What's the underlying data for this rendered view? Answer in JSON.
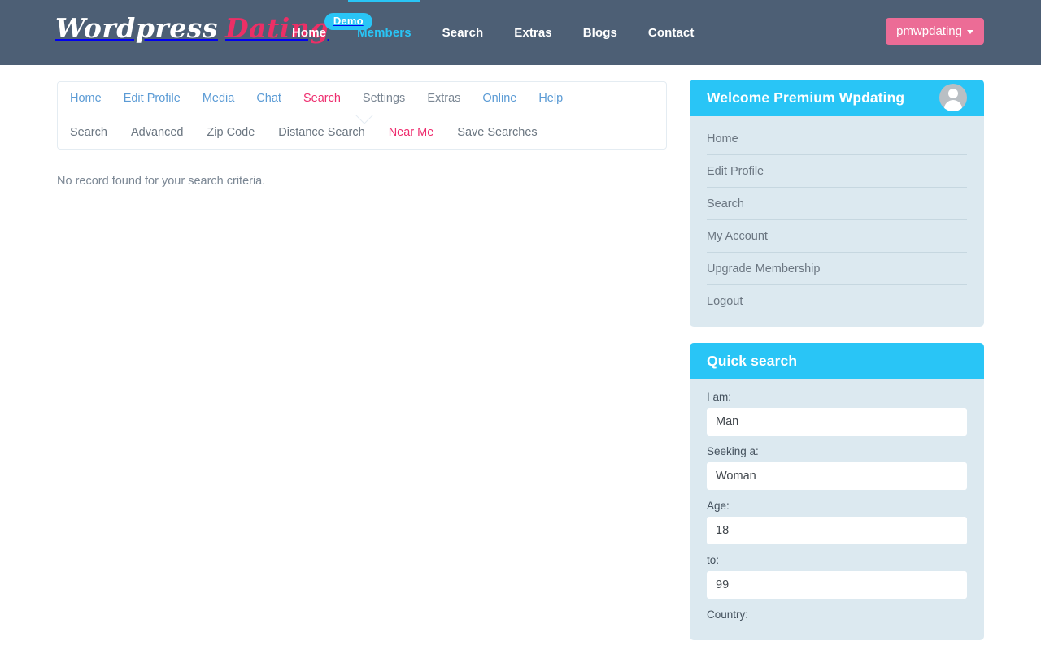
{
  "header": {
    "brand": {
      "word": "Wordpress",
      "dating": "Dating",
      "badge": "Demo"
    },
    "nav": [
      {
        "label": "Home",
        "active": false
      },
      {
        "label": "Members",
        "active": true
      },
      {
        "label": "Search",
        "active": false
      },
      {
        "label": "Extras",
        "active": false
      },
      {
        "label": "Blogs",
        "active": false
      },
      {
        "label": "Contact",
        "active": false
      }
    ],
    "user_button": {
      "label": "pmwpdating",
      "caret_icon": "chevron-down-icon"
    }
  },
  "content": {
    "primary_tabs": [
      {
        "label": "Home",
        "style": "link"
      },
      {
        "label": "Edit Profile",
        "style": "link"
      },
      {
        "label": "Media",
        "style": "link"
      },
      {
        "label": "Chat",
        "style": "link"
      },
      {
        "label": "Search",
        "style": "pink"
      },
      {
        "label": "Settings",
        "style": "muted"
      },
      {
        "label": "Extras",
        "style": "muted"
      },
      {
        "label": "Online",
        "style": "link"
      },
      {
        "label": "Help",
        "style": "link"
      }
    ],
    "secondary_tabs": [
      {
        "label": "Search",
        "style": "plain"
      },
      {
        "label": "Advanced",
        "style": "plain"
      },
      {
        "label": "Zip Code",
        "style": "plain"
      },
      {
        "label": "Distance Search",
        "style": "plain"
      },
      {
        "label": "Near Me",
        "style": "pink"
      },
      {
        "label": "Save Searches",
        "style": "plain"
      }
    ],
    "empty_message": "No record found for your search criteria."
  },
  "sidebar": {
    "welcome_panel": {
      "title": "Welcome Premium Wpdating",
      "avatar_icon": "user-avatar-icon",
      "items": [
        {
          "label": "Home"
        },
        {
          "label": "Edit Profile"
        },
        {
          "label": "Search"
        },
        {
          "label": "My Account"
        },
        {
          "label": "Upgrade Membership"
        },
        {
          "label": "Logout"
        }
      ]
    },
    "quick_search": {
      "title": "Quick search",
      "fields": [
        {
          "label": "I am:",
          "value": "Man"
        },
        {
          "label": "Seeking a:",
          "value": "Woman"
        },
        {
          "label": "Age:",
          "value": "18"
        },
        {
          "label": "to:",
          "value": "99"
        },
        {
          "label": "Country:",
          "value": ""
        }
      ]
    }
  },
  "colors": {
    "header_bg": "#4d5f75",
    "accent_cyan": "#29c5f6",
    "accent_pink": "#ec2f66",
    "button_pink": "#ec6c96",
    "panel_bg": "#dce9f0",
    "link_blue": "#5b9bd5"
  }
}
